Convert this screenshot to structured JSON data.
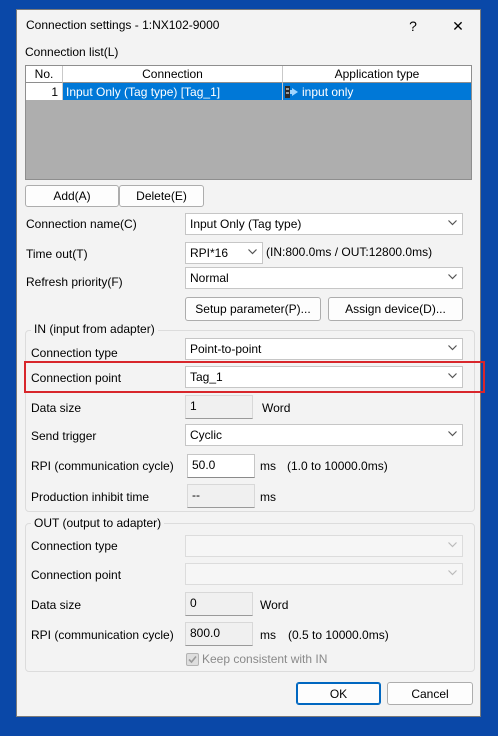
{
  "window": {
    "title": "Connection settings  - 1:NX102-9000",
    "help_glyph": "?",
    "close_glyph": "✕"
  },
  "connection_list": {
    "label": "Connection list(L)",
    "columns": [
      "No.",
      "Connection",
      "Application type"
    ],
    "rows": [
      {
        "no": "1",
        "connection": "Input Only (Tag type) [Tag_1]",
        "application_type": "input only",
        "selected": true
      }
    ],
    "add_label": "Add(A)",
    "delete_label": "Delete(E)"
  },
  "general": {
    "connection_name_label": "Connection name(C)",
    "connection_name_value": "Input Only (Tag type)",
    "timeout_label": "Time out(T)",
    "timeout_value": "RPI*16",
    "timeout_info": "(IN:800.0ms / OUT:12800.0ms)",
    "refresh_priority_label": "Refresh priority(F)",
    "refresh_priority_value": "Normal",
    "setup_parameter_label": "Setup parameter(P)...",
    "assign_device_label": "Assign device(D)..."
  },
  "in_group": {
    "title": "IN (input from adapter)",
    "connection_type_label": "Connection type",
    "connection_type_value": "Point-to-point",
    "connection_point_label": "Connection point",
    "connection_point_value": "Tag_1",
    "data_size_label": "Data size",
    "data_size_value": "1",
    "data_size_unit": "Word",
    "send_trigger_label": "Send trigger",
    "send_trigger_value": "Cyclic",
    "rpi_label": "RPI (communication cycle)",
    "rpi_value": "50.0",
    "rpi_unit": "ms",
    "rpi_range": "(1.0 to 10000.0ms)",
    "inhibit_label": "Production inhibit time",
    "inhibit_value": "--",
    "inhibit_unit": "ms"
  },
  "out_group": {
    "title": "OUT (output to adapter)",
    "connection_type_label": "Connection type",
    "connection_type_value": "",
    "connection_point_label": "Connection point",
    "connection_point_value": "",
    "data_size_label": "Data size",
    "data_size_value": "0",
    "data_size_unit": "Word",
    "rpi_label": "RPI (communication cycle)",
    "rpi_value": "800.0",
    "rpi_unit": "ms",
    "rpi_range": "(0.5 to 10000.0ms)",
    "keep_consistent_label": "Keep consistent with IN",
    "keep_consistent_checked": true
  },
  "footer": {
    "ok_label": "OK",
    "cancel_label": "Cancel"
  },
  "colors": {
    "background": "#0a48a8",
    "selection": "#0078d7",
    "highlight_border": "#d8262b",
    "accent": "#0067c0"
  }
}
